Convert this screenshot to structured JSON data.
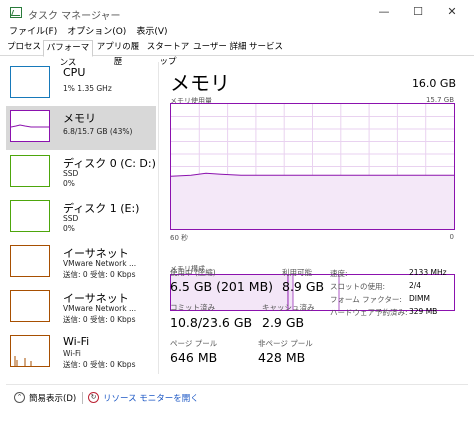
{
  "window": {
    "title": "タスク マネージャー",
    "minimize_glyph": "—",
    "maximize_glyph": "☐",
    "close_glyph": "✕"
  },
  "menu": [
    "ファイル(F)",
    "オプション(O)",
    "表示(V)"
  ],
  "tabs": [
    "プロセス",
    "パフォーマンス",
    "アプリの履歴",
    "スタートアップ",
    "ユーザー",
    "詳細",
    "サービス"
  ],
  "active_tab": "パフォーマンス",
  "resources": [
    {
      "name": "CPU",
      "line1": "1%  1.35 GHz",
      "line2": ""
    },
    {
      "name": "メモリ",
      "line1": "6.8/15.7 GB (43%)",
      "line2": ""
    },
    {
      "name": "ディスク 0 (C: D:)",
      "line1": "SSD",
      "line2": "0%"
    },
    {
      "name": "ディスク 1 (E:)",
      "line1": "SSD",
      "line2": "0%"
    },
    {
      "name": "イーサネット",
      "line1": "VMware Network ...",
      "line2": "送信: 0 受信: 0 Kbps"
    },
    {
      "name": "イーサネット",
      "line1": "VMware Network ...",
      "line2": "送信: 0 受信: 0 Kbps"
    },
    {
      "name": "Wi-Fi",
      "line1": "Wi-Fi",
      "line2": "送信: 0 受信: 0 Kbps"
    }
  ],
  "colors": {
    "cpu": "#1779ba",
    "memory": "#8b12ae",
    "disk": "#4da60c",
    "network": "#a74f01",
    "selected_bg": "#d8d8d8"
  },
  "detail": {
    "title": "メモリ",
    "total": "16.0 GB",
    "usage_label": "メモリ使用量",
    "usage_max": "15.7 GB",
    "axis_left": "60 秒",
    "axis_right": "0",
    "composition_label": "メモリ構成",
    "memory_usage_fraction": 0.43,
    "stats": {
      "in_use_label": "使用中 (圧縮)",
      "in_use_value": "6.5 GB (201 MB)",
      "available_label": "利用可能",
      "available_value": "8.9 GB",
      "committed_label": "コミット済み",
      "committed_value": "10.8/23.6 GB",
      "cached_label": "キャッシュ済み",
      "cached_value": "2.9 GB",
      "paged_label": "ページ プール",
      "paged_value": "646 MB",
      "nonpaged_label": "非ページ プール",
      "nonpaged_value": "428 MB"
    },
    "properties": [
      {
        "key": "速度:",
        "value": "2133 MHz"
      },
      {
        "key": "スロットの使用:",
        "value": "2/4"
      },
      {
        "key": "フォーム ファクター:",
        "value": "DIMM"
      },
      {
        "key": "ハードウェア予約済み:",
        "value": "329 MB"
      }
    ]
  },
  "footer": {
    "fewer_details": "簡易表示(D)",
    "resource_monitor": "リソース モニターを開く"
  }
}
